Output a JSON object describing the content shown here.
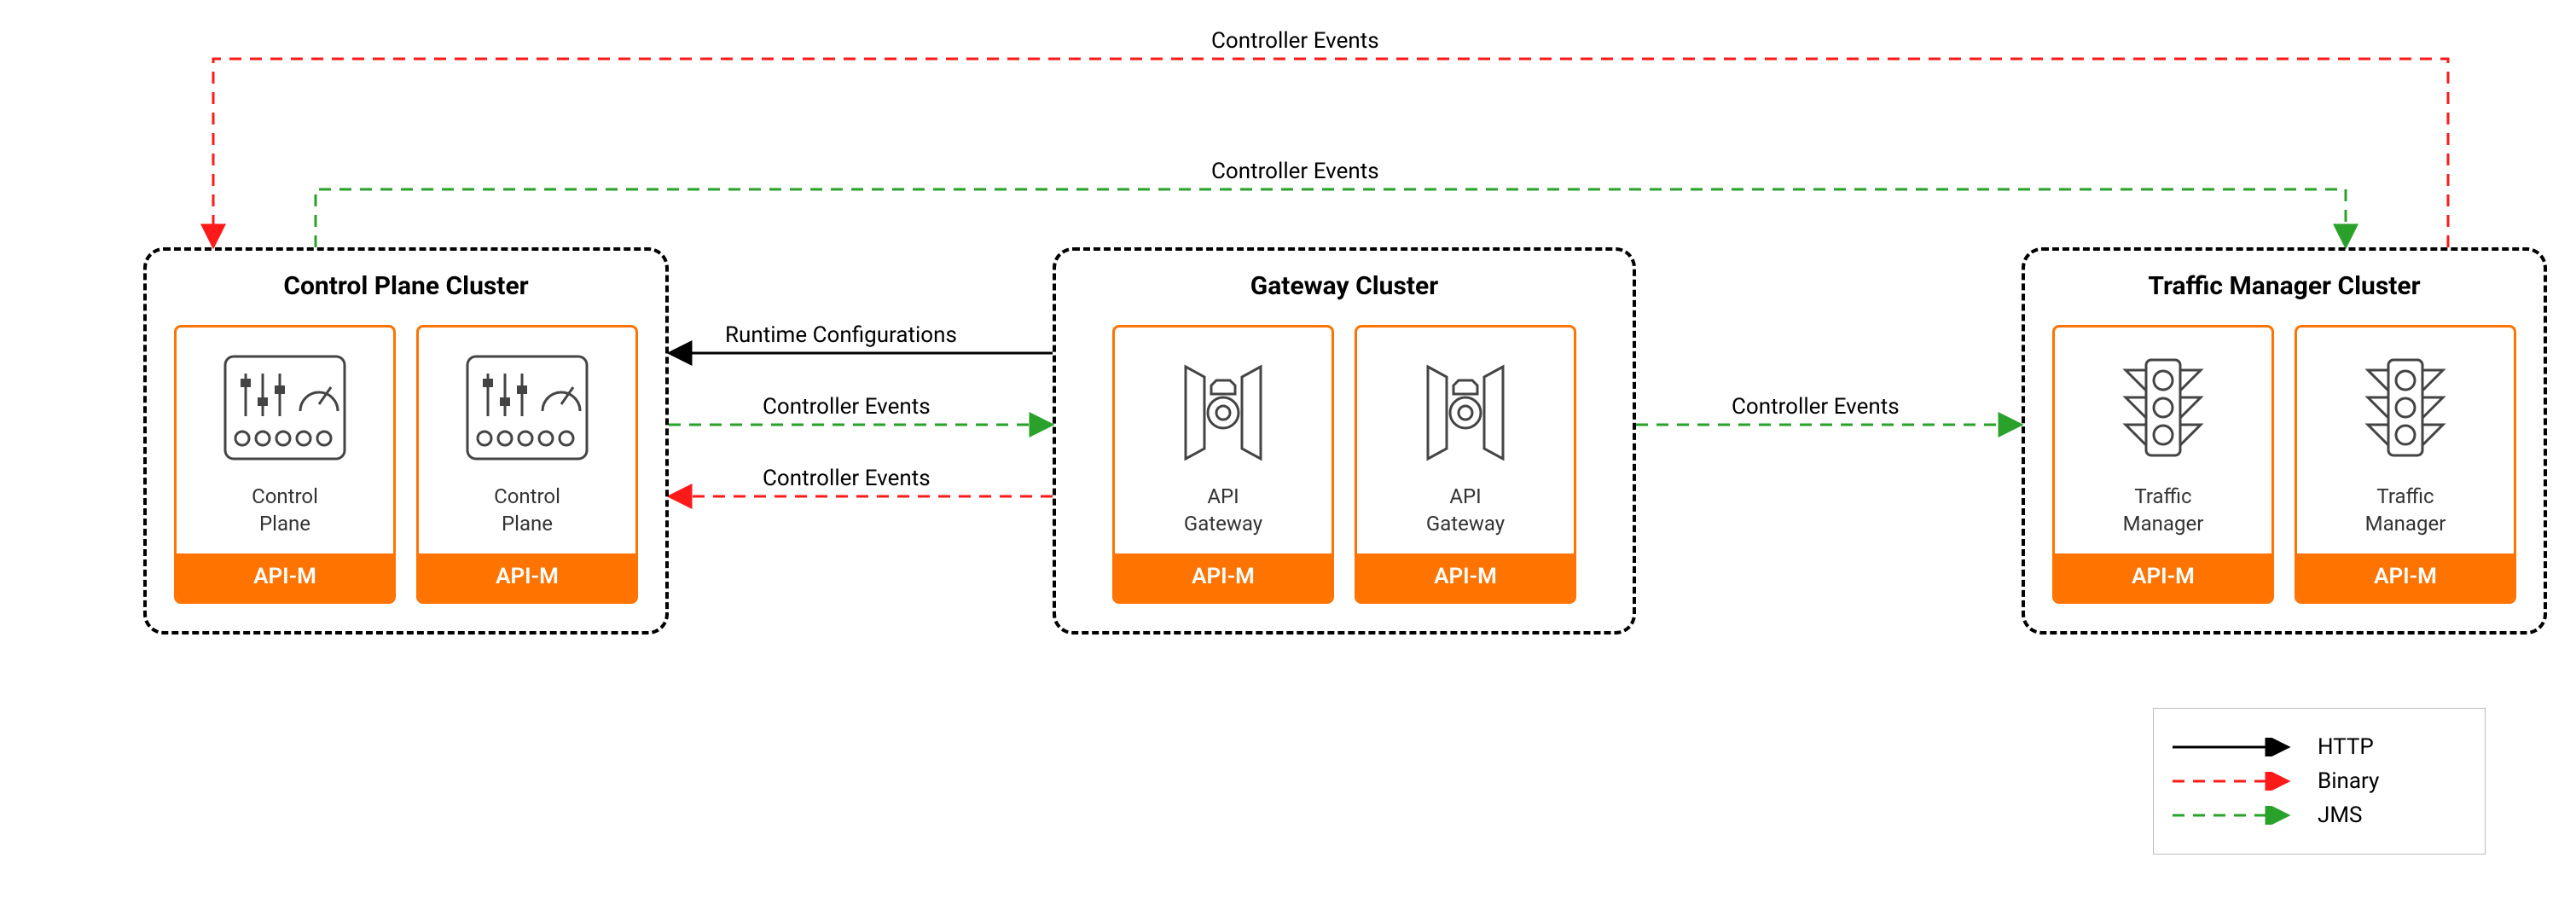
{
  "clusters": {
    "control_plane": {
      "title": "Control Plane Cluster",
      "nodes": [
        {
          "label_line1": "Control",
          "label_line2": "Plane",
          "badge": "API-M"
        },
        {
          "label_line1": "Control",
          "label_line2": "Plane",
          "badge": "API-M"
        }
      ]
    },
    "gateway": {
      "title": "Gateway Cluster",
      "nodes": [
        {
          "label_line1": "API",
          "label_line2": "Gateway",
          "badge": "API-M"
        },
        {
          "label_line1": "API",
          "label_line2": "Gateway",
          "badge": "API-M"
        }
      ]
    },
    "traffic_manager": {
      "title": "Traffic Manager Cluster",
      "nodes": [
        {
          "label_line1": "Traffic",
          "label_line2": "Manager",
          "badge": "API-M"
        },
        {
          "label_line1": "Traffic",
          "label_line2": "Manager",
          "badge": "API-M"
        }
      ]
    }
  },
  "connections": {
    "gw_to_cp_http": "Runtime Configurations",
    "gw_to_cp_jms": "Controller Events",
    "gw_to_cp_binary": "Controller Events",
    "gw_to_tm_jms": "Controller Events",
    "tm_to_cp_jms_top": "Controller Events",
    "tm_to_cp_binary_top": "Controller Events"
  },
  "legend": {
    "http": "HTTP",
    "binary": "Binary",
    "jms": "JMS"
  },
  "colors": {
    "accent": "#ff7300",
    "binary": "#ff1a1a",
    "jms": "#2aa12a",
    "http": "#000000"
  }
}
